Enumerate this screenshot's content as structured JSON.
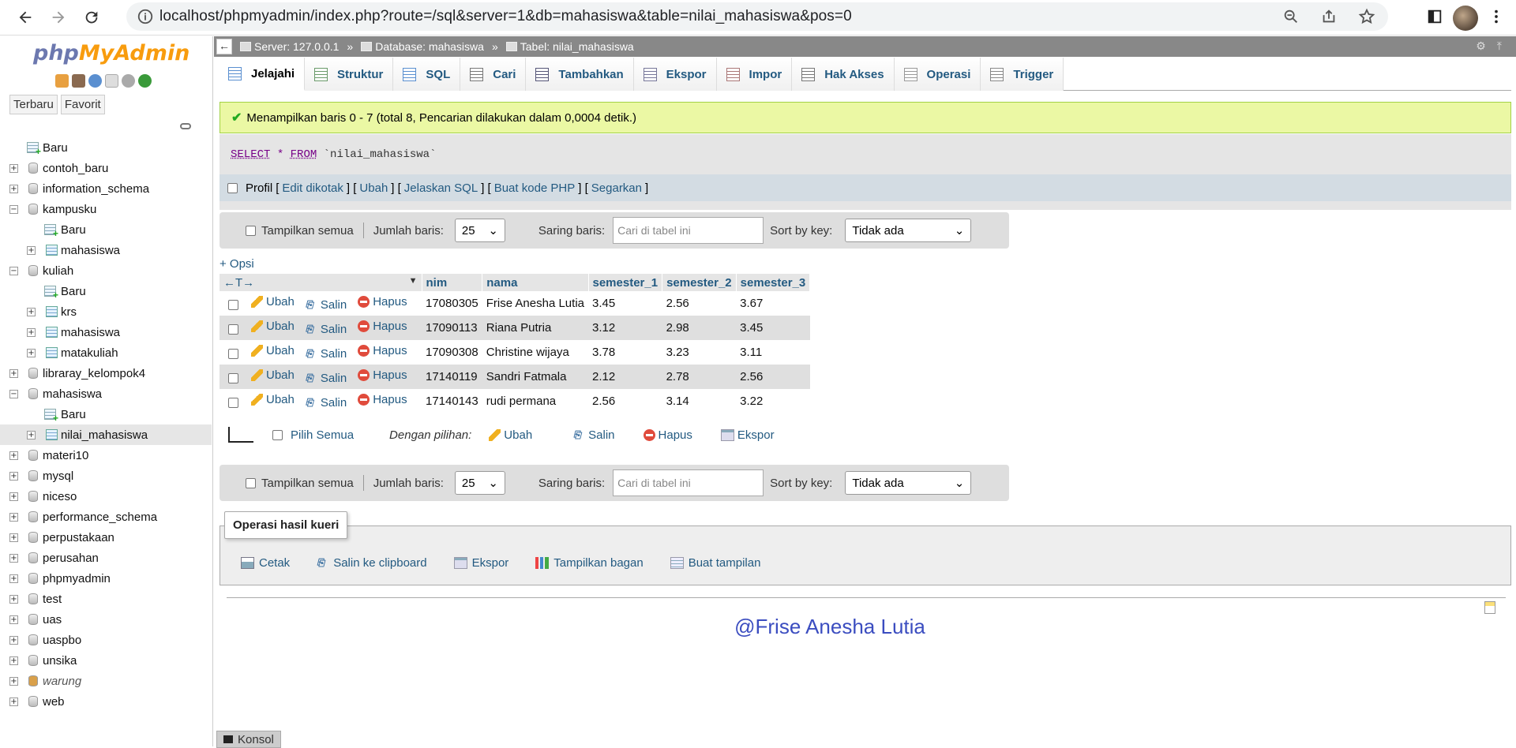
{
  "browser": {
    "url": "localhost/phpmyadmin/index.php?route=/sql&server=1&db=mahasiswa&table=nilai_mahasiswa&pos=0"
  },
  "sidebar": {
    "logo_php": "php",
    "logo_my": "MyAdmin",
    "tab_recent": "Terbaru",
    "tab_favorite": "Favorit",
    "tree": [
      {
        "label": "Baru",
        "type": "new",
        "level": 0
      },
      {
        "label": "contoh_baru",
        "type": "db",
        "level": 0
      },
      {
        "label": "information_schema",
        "type": "db",
        "level": 0
      },
      {
        "label": "kampusku",
        "type": "db",
        "level": 0,
        "expanded": true
      },
      {
        "label": "Baru",
        "type": "new",
        "level": 1
      },
      {
        "label": "mahasiswa",
        "type": "table",
        "level": 1
      },
      {
        "label": "kuliah",
        "type": "db",
        "level": 0,
        "expanded": true
      },
      {
        "label": "Baru",
        "type": "new",
        "level": 1
      },
      {
        "label": "krs",
        "type": "table",
        "level": 1
      },
      {
        "label": "mahasiswa",
        "type": "table",
        "level": 1
      },
      {
        "label": "matakuliah",
        "type": "table",
        "level": 1
      },
      {
        "label": "libraray_kelompok4",
        "type": "db",
        "level": 0
      },
      {
        "label": "mahasiswa",
        "type": "db",
        "level": 0,
        "expanded": true
      },
      {
        "label": "Baru",
        "type": "new",
        "level": 1
      },
      {
        "label": "nilai_mahasiswa",
        "type": "table",
        "level": 1,
        "active": true
      },
      {
        "label": "materi10",
        "type": "db",
        "level": 0
      },
      {
        "label": "mysql",
        "type": "db",
        "level": 0
      },
      {
        "label": "niceso",
        "type": "db",
        "level": 0
      },
      {
        "label": "performance_schema",
        "type": "db",
        "level": 0
      },
      {
        "label": "perpustakaan",
        "type": "db",
        "level": 0
      },
      {
        "label": "perusahan",
        "type": "db",
        "level": 0
      },
      {
        "label": "phpmyadmin",
        "type": "db",
        "level": 0
      },
      {
        "label": "test",
        "type": "db",
        "level": 0
      },
      {
        "label": "uas",
        "type": "db",
        "level": 0
      },
      {
        "label": "uaspbo",
        "type": "db",
        "level": 0
      },
      {
        "label": "unsika",
        "type": "db",
        "level": 0
      },
      {
        "label": "warung",
        "type": "warung",
        "level": 0,
        "italic": true
      },
      {
        "label": "web",
        "type": "db",
        "level": 0
      }
    ]
  },
  "breadcrumb": {
    "server": "Server: 127.0.0.1",
    "database": "Database: mahasiswa",
    "table": "Tabel: nilai_mahasiswa",
    "sep": "»"
  },
  "tabs": [
    "Jelajahi",
    "Struktur",
    "SQL",
    "Cari",
    "Tambahkan",
    "Ekspor",
    "Impor",
    "Hak Akses",
    "Operasi",
    "Trigger"
  ],
  "success_message": "Menampilkan baris 0 - 7 (total 8, Pencarian dilakukan dalam 0,0004 detik.)",
  "sql": {
    "select": "SELECT",
    "star": " * ",
    "from": "FROM",
    "table": " `nilai_mahasiswa`"
  },
  "profile": {
    "label": "Profil",
    "links": [
      "Edit dikotak",
      "Ubah",
      "Jelaskan SQL",
      "Buat kode PHP",
      "Segarkan"
    ]
  },
  "navbar": {
    "show_all": "Tampilkan semua",
    "rows_label": "Jumlah baris:",
    "rows_value": "25",
    "filter_label": "Saring baris:",
    "filter_placeholder": "Cari di tabel ini",
    "sort_label": "Sort by key:",
    "sort_value": "Tidak ada"
  },
  "options_link": "+ Opsi",
  "table": {
    "columns": [
      "nim",
      "nama",
      "semester_1",
      "semester_2",
      "semester_3"
    ],
    "actions": {
      "edit": "Ubah",
      "copy": "Salin",
      "delete": "Hapus"
    },
    "rows": [
      [
        "17080305",
        "Frise Anesha Lutia",
        "3.45",
        "2.56",
        "3.67"
      ],
      [
        "17090113",
        "Riana Putria",
        "3.12",
        "2.98",
        "3.45"
      ],
      [
        "17090308",
        "Christine wijaya",
        "3.78",
        "3.23",
        "3.11"
      ],
      [
        "17140119",
        "Sandri Fatmala",
        "2.12",
        "2.78",
        "2.56"
      ],
      [
        "17140143",
        "rudi permana",
        "2.56",
        "3.14",
        "3.22"
      ]
    ]
  },
  "with_selected": {
    "check_all": "Pilih Semua",
    "label": "Dengan pilihan:",
    "edit": "Ubah",
    "copy": "Salin",
    "delete": "Hapus",
    "export": "Ekspor"
  },
  "query_ops": {
    "legend": "Operasi hasil kueri",
    "items": [
      "Cetak",
      "Salin ke clipboard",
      "Ekspor",
      "Tampilkan bagan",
      "Buat tampilan"
    ]
  },
  "footer_name": "@Frise Anesha Lutia",
  "console": "Konsol"
}
